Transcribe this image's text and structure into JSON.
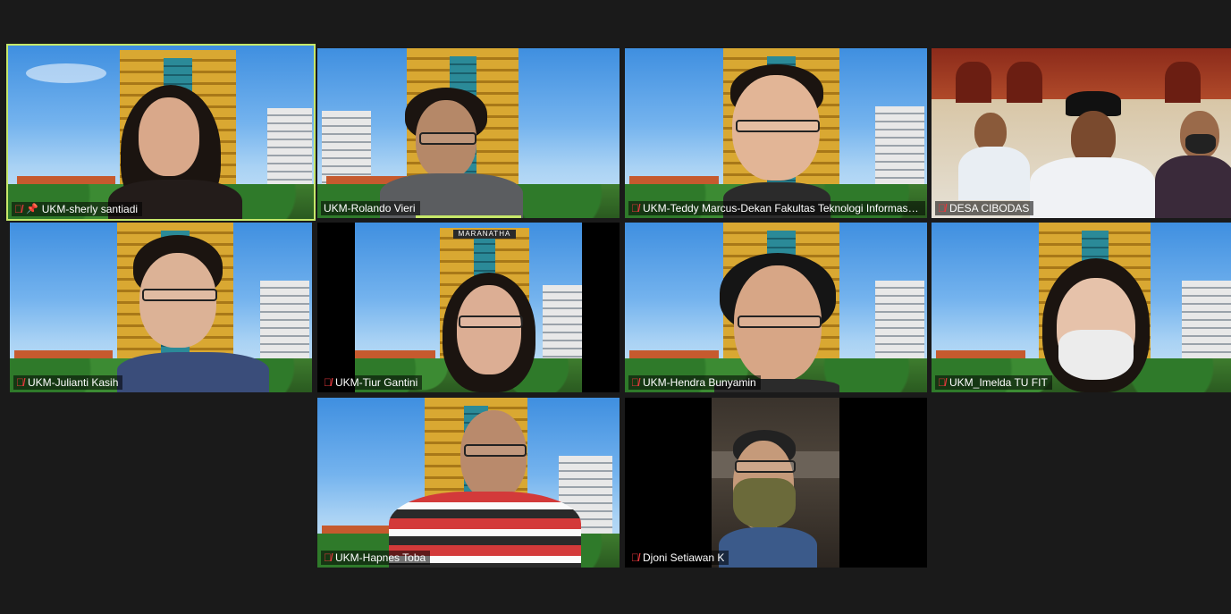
{
  "meeting": {
    "participants": [
      {
        "name": "UKM-sherly santiadi",
        "muted": true,
        "pinned": true,
        "active_speaker": true
      },
      {
        "name": "UKM-Rolando Vieri",
        "muted": false,
        "pinned": false
      },
      {
        "name": "UKM-Teddy Marcus-Dekan Fakultas Teknologi Informasi Mar...",
        "muted": true,
        "pinned": false
      },
      {
        "name": "DESA CIBODAS",
        "muted": true,
        "pinned": false
      },
      {
        "name": "UKM-Julianti Kasih",
        "muted": true,
        "pinned": false
      },
      {
        "name": "UKM-Tiur Gantini",
        "muted": true,
        "pinned": false
      },
      {
        "name": "UKM-Hendra Bunyamin",
        "muted": true,
        "pinned": false
      },
      {
        "name": "UKM_Imelda TU FIT",
        "muted": true,
        "pinned": false
      },
      {
        "name": "UKM-Hapnes Toba",
        "muted": true,
        "pinned": false
      },
      {
        "name": "Djoni Setiawan K",
        "muted": true,
        "pinned": false
      }
    ],
    "background_sign": "MARANATHA"
  },
  "colors": {
    "active_speaker_border": "#c6e86a",
    "muted_icon": "#e8383d",
    "page_background": "#1a1a1a"
  },
  "icons": {
    "muted": "mic-off-icon",
    "pinned": "pin-icon"
  }
}
